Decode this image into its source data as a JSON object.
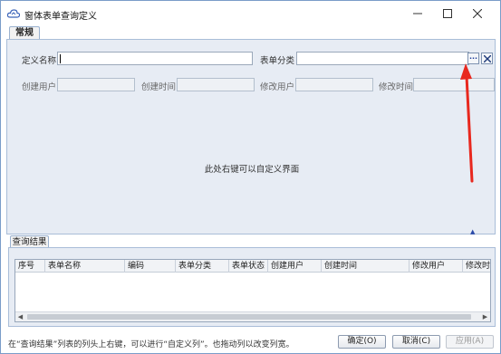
{
  "window": {
    "title": "窗体表单查询定义",
    "icon": "cloud-app-icon",
    "controls": {
      "minimize": "—",
      "maximize": "☐",
      "close": "✕"
    }
  },
  "tabs": {
    "general": "常规",
    "result": "查询结果"
  },
  "form": {
    "definition_name_label": "定义名称",
    "definition_name_value": "",
    "form_category_label": "表单分类",
    "form_category_value": "",
    "browse_label": "...",
    "created_user_label": "创建用户",
    "created_time_label": "创建时间",
    "modified_user_label": "修改用户",
    "modified_time_label": "修改时间"
  },
  "custom_area_message": "此处右键可以自定义界面",
  "grid": {
    "columns": [
      "序号",
      "表单名称",
      "编码",
      "表单分类",
      "表单状态",
      "创建用户",
      "创建时间",
      "修改用户",
      "修改时"
    ]
  },
  "status": {
    "hint": "在“查询结果”列表的列头上右键，可以进行“自定义列”。也拖动列以改变列宽。"
  },
  "buttons": {
    "ok": "确定(O)",
    "cancel": "取消(C)",
    "apply": "应用(A)"
  },
  "colors": {
    "accent_arrow": "#e8281e",
    "panel_bg": "#e7ecf4",
    "border": "#a9bdd8"
  }
}
